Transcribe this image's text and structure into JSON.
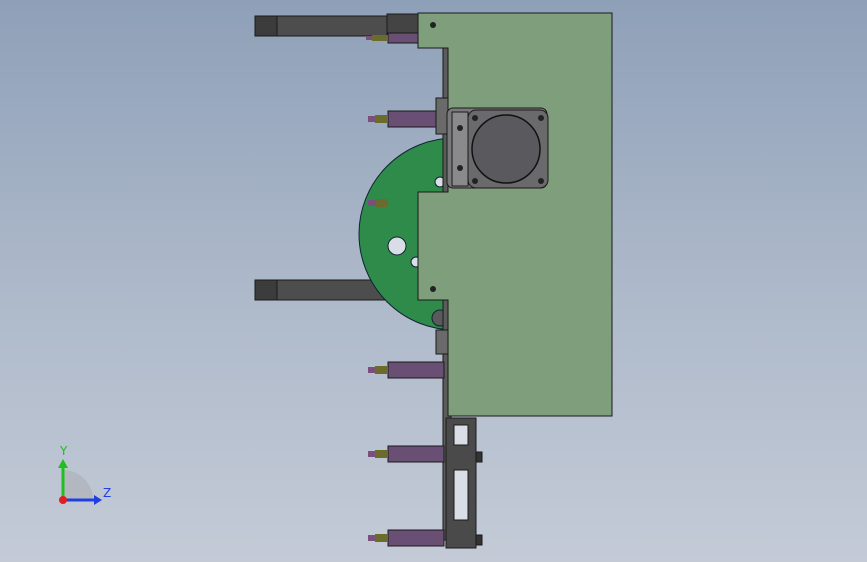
{
  "viewport": {
    "background_top": "#8ea0b8",
    "background_bottom": "#c4cbd7"
  },
  "model": {
    "plate_color": "#7f9e7c",
    "disc_color": "#2e8b4a",
    "bracket_color": "#5a5a5a",
    "cylinder_color": "#5f5066",
    "rod_color": "#7a4f7e",
    "motor_color": "#6e6e72",
    "arm_color": "#4a4a4a"
  },
  "triad": {
    "y_label": "Y",
    "z_label": "Z",
    "y_color": "#1fbf1f",
    "z_color": "#1f3fdf",
    "x_color": "#df1f1f"
  }
}
